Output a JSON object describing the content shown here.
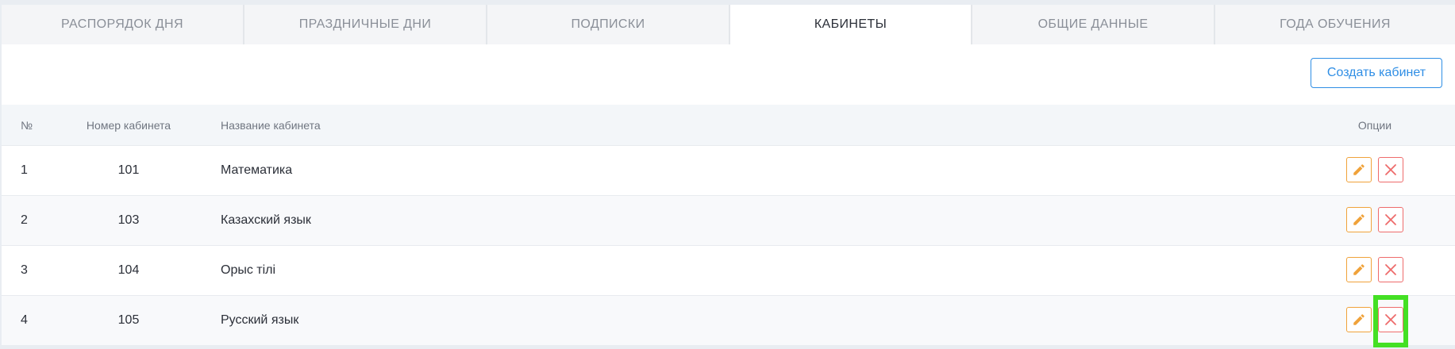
{
  "tabs": [
    {
      "label": "РАСПОРЯДОК ДНЯ",
      "active": false
    },
    {
      "label": "ПРАЗДНИЧНЫЕ ДНИ",
      "active": false
    },
    {
      "label": "ПОДПИСКИ",
      "active": false
    },
    {
      "label": "КАБИНЕТЫ",
      "active": true
    },
    {
      "label": "ОБЩИЕ ДАННЫЕ",
      "active": false
    },
    {
      "label": "ГОДА ОБУЧЕНИЯ",
      "active": false
    }
  ],
  "toolbar": {
    "create_label": "Создать кабинет"
  },
  "table": {
    "headers": {
      "num": "№",
      "room": "Номер кабинета",
      "name": "Название кабинета",
      "options": "Опции"
    },
    "rows": [
      {
        "num": "1",
        "room": "101",
        "name": "Математика"
      },
      {
        "num": "2",
        "room": "103",
        "name": "Казахский язык"
      },
      {
        "num": "3",
        "room": "104",
        "name": "Орыс тілі"
      },
      {
        "num": "4",
        "room": "105",
        "name": "Русский язык"
      }
    ]
  },
  "colors": {
    "accent": "#2f8ee5",
    "edit": "#f0a23a",
    "delete": "#ee6b6b",
    "highlight": "#44e024"
  },
  "icons": {
    "edit": "pencil-icon",
    "delete": "close-icon"
  }
}
